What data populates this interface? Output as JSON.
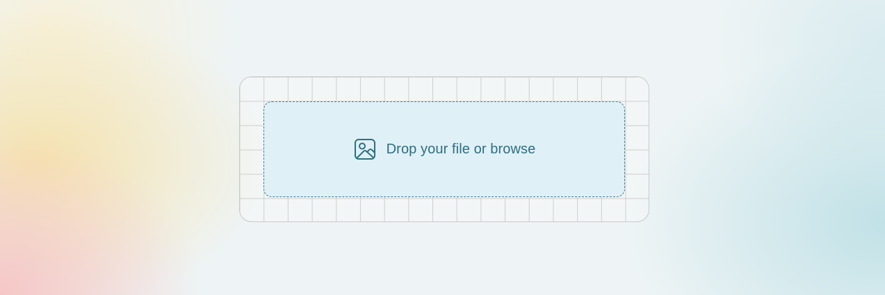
{
  "uploader": {
    "label": "Drop your file or browse",
    "icon": "image-icon",
    "accent_color": "#2e6f82",
    "dropzone_color": "#dff0f6",
    "border_color": "#3f7e8e"
  }
}
